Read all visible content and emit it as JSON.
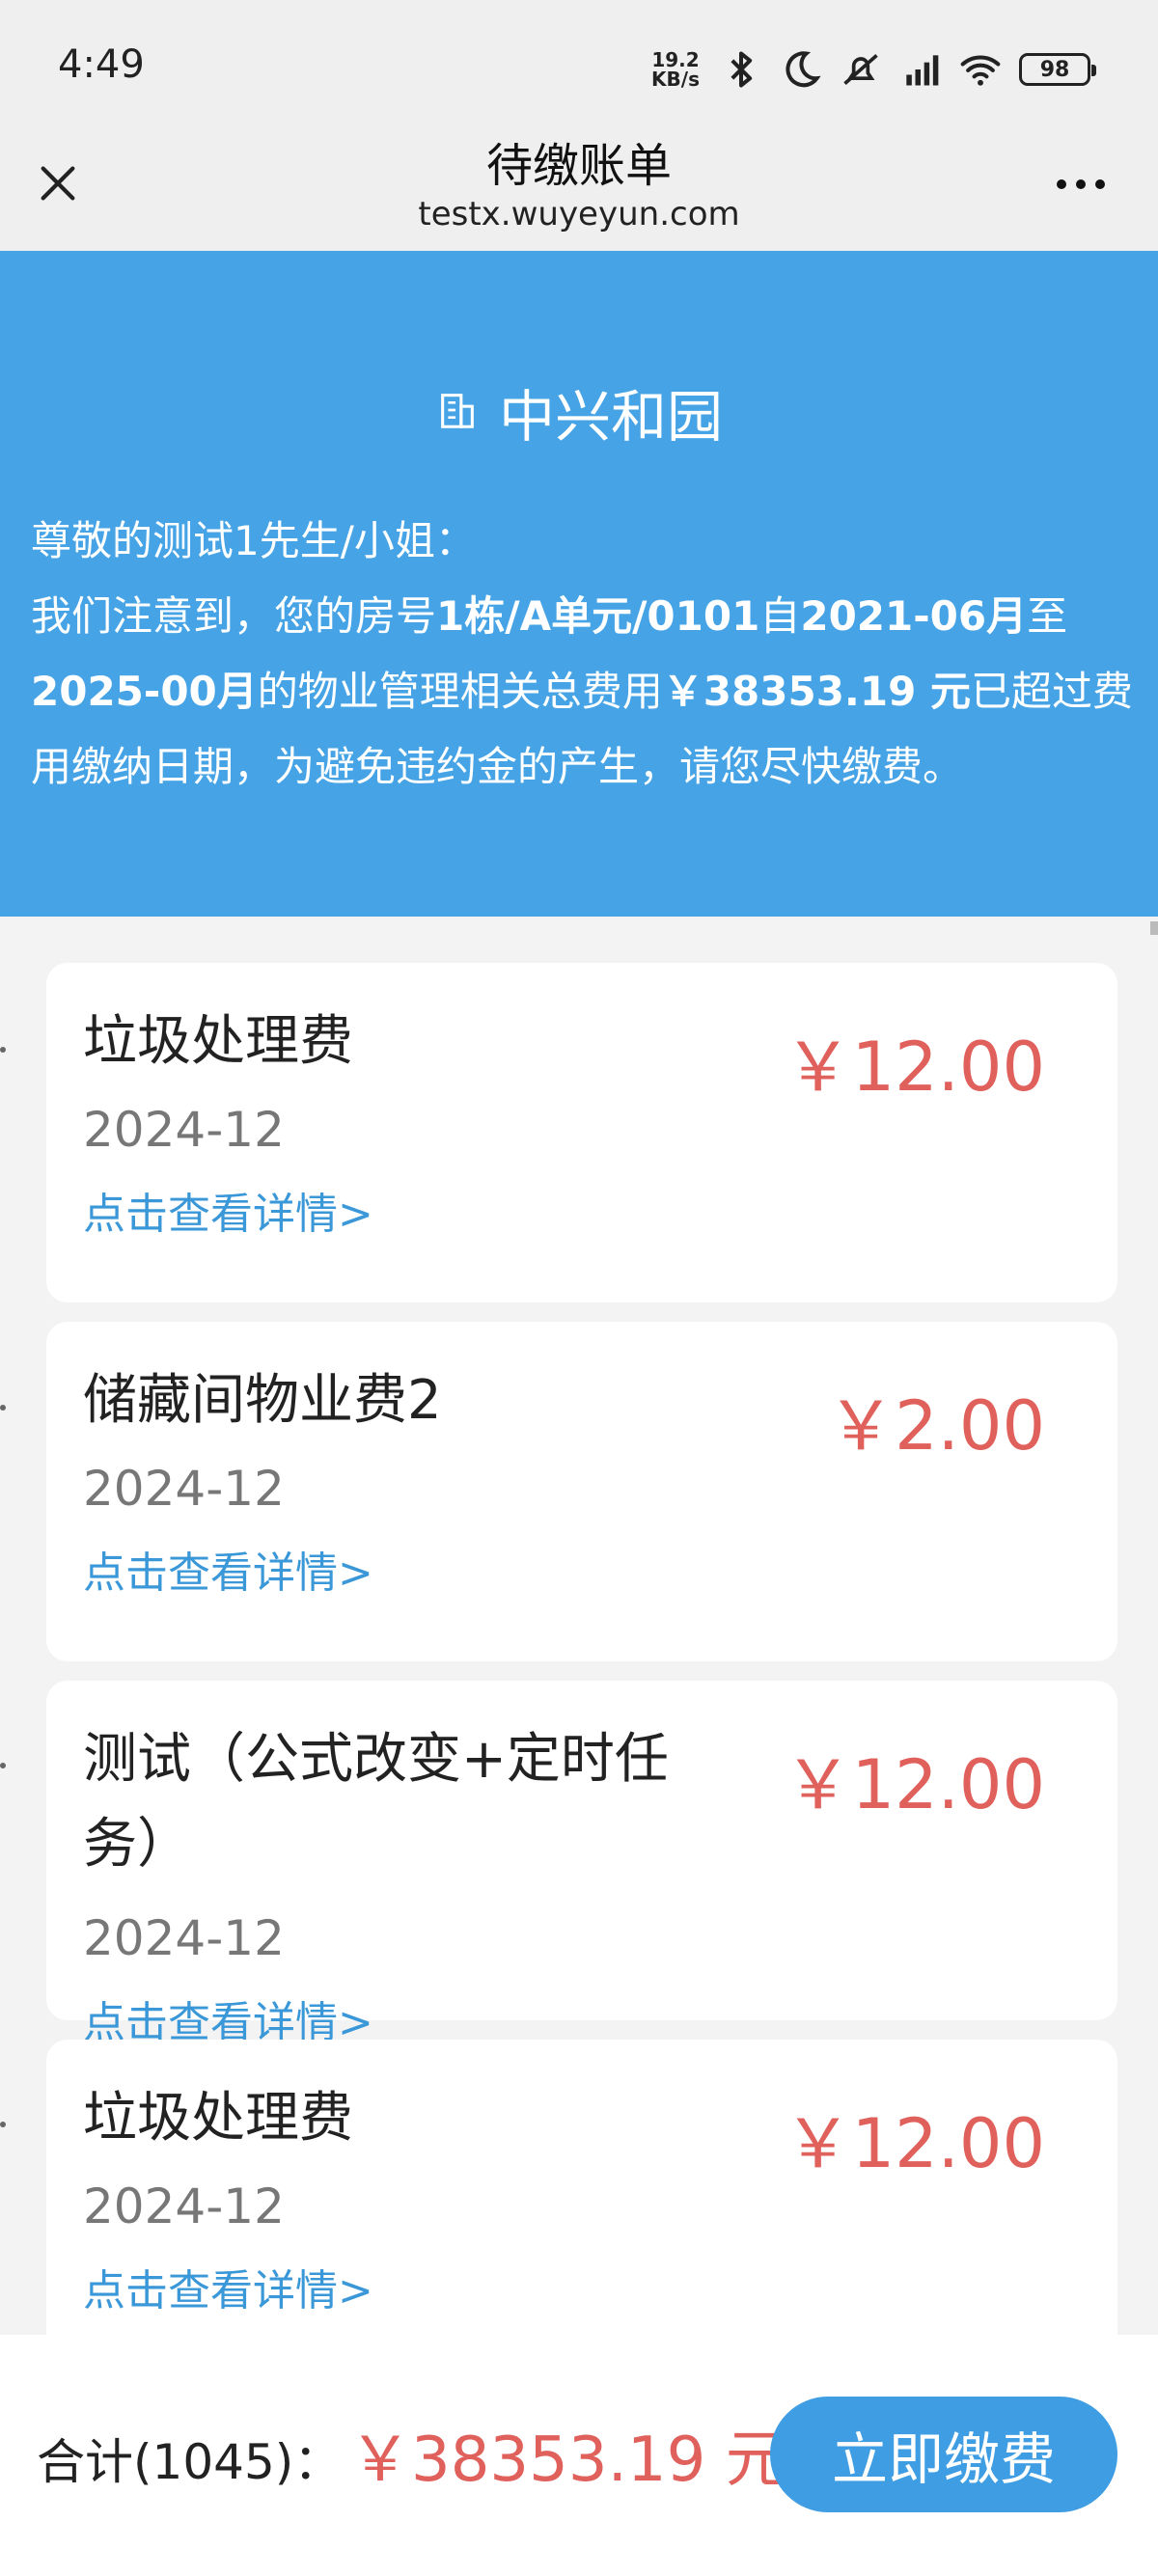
{
  "status_bar": {
    "time": "4:49",
    "net_speed_value": "19.2",
    "net_speed_unit": "KB/s",
    "battery": "98",
    "icons": [
      "bluetooth-icon",
      "moon-icon",
      "mute-icon",
      "hd-signal-icon",
      "wifi-icon",
      "battery-icon"
    ]
  },
  "header": {
    "title": "待缴账单",
    "url": "testx.wuyeyun.com"
  },
  "banner": {
    "community": "中兴和园",
    "notice": {
      "greeting": "尊敬的测试1先生/小姐：",
      "p1": "我们注意到，您的房号",
      "room": "1栋/A单元/0101",
      "p2": "自",
      "from": "2021-06月",
      "p3": "至",
      "to": "2025-00月",
      "p4": "的物业管理相关总费用",
      "total": "￥38353.19 元",
      "p5": "已超过费用缴纳日期，为避免违约金的产生，请您尽快缴费。"
    }
  },
  "bills": [
    {
      "name_line1": "垃圾处理费",
      "name_line2": "",
      "date": "2024-12",
      "link": "点击查看详情>",
      "amount": "￥12.00"
    },
    {
      "name_line1": "储藏间物业费2",
      "name_line2": "",
      "date": "2024-12",
      "link": "点击查看详情>",
      "amount": "￥2.00"
    },
    {
      "name_line1": "测试（公式改变+定时任",
      "name_line2": "务）",
      "date": "2024-12",
      "link": "点击查看详情>",
      "amount": "￥12.00"
    },
    {
      "name_line1": "垃圾处理费",
      "name_line2": "",
      "date": "2024-12",
      "link": "点击查看详情>",
      "amount": "￥12.00"
    }
  ],
  "footer": {
    "total_label": "合计(1045)：",
    "total_amount": "￥38353.19 元",
    "pay_button": "立即缴费"
  },
  "colors": {
    "banner": "#45a3e6",
    "amount": "#e0605c",
    "link": "#3a97d8",
    "pay_button": "#3f9de3"
  }
}
